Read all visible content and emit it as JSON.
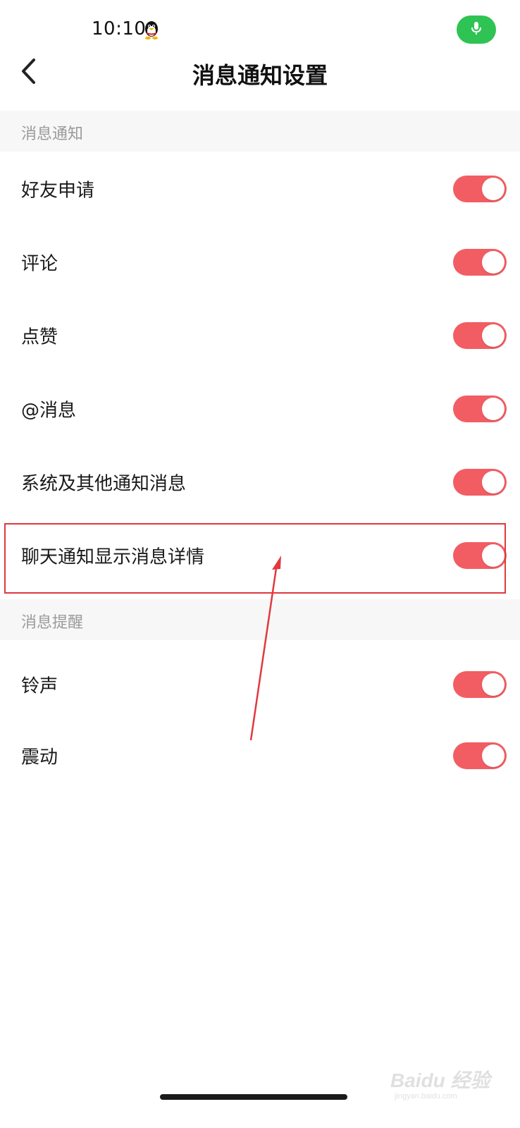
{
  "status_bar": {
    "time": "10:10"
  },
  "header": {
    "title": "消息通知设置"
  },
  "sections": [
    {
      "title": "消息通知",
      "items": [
        {
          "label": "好友申请",
          "enabled": true
        },
        {
          "label": "评论",
          "enabled": true
        },
        {
          "label": "点赞",
          "enabled": true
        },
        {
          "label": "@消息",
          "enabled": true
        },
        {
          "label": "系统及其他通知消息",
          "enabled": true
        },
        {
          "label": "聊天通知显示消息详情",
          "enabled": true
        }
      ]
    },
    {
      "title": "消息提醒",
      "items": [
        {
          "label": "铃声",
          "enabled": true
        },
        {
          "label": "震动",
          "enabled": true
        }
      ]
    }
  ],
  "watermark": {
    "text": "Baidu 经验",
    "sub": "jingyan.baidu.com"
  },
  "colors": {
    "toggle_on": "#f25d63",
    "mic_pill": "#2fc353",
    "annotation": "#e0393e",
    "section_bg": "#f7f7f7"
  },
  "icons": {
    "back": "chevron-left-icon",
    "mic": "microphone-icon",
    "qq": "qq-penguin-icon"
  }
}
